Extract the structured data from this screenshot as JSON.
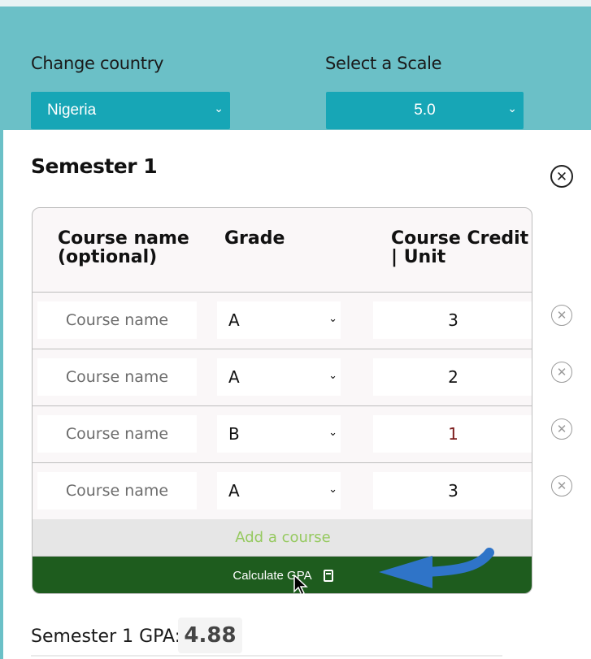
{
  "controls": {
    "country_label": "Change country",
    "country_value": "Nigeria",
    "scale_label": "Select a Scale",
    "scale_value": "5.0"
  },
  "semester": {
    "title": "Semester 1",
    "headers": {
      "course": "Course name (optional)",
      "grade": "Grade",
      "credit": "Course Credit | Unit"
    },
    "rows": [
      {
        "course_placeholder": "Course name",
        "grade": "A",
        "credit": "3"
      },
      {
        "course_placeholder": "Course name",
        "grade": "A",
        "credit": "2"
      },
      {
        "course_placeholder": "Course name",
        "grade": "B",
        "credit": "1"
      },
      {
        "course_placeholder": "Course name",
        "grade": "A",
        "credit": "3"
      }
    ],
    "add_course_label": "Add a course",
    "calculate_label": "Calculate GPA",
    "gpa_label": "Semester 1 GPA:",
    "gpa_value": "4.88"
  },
  "colors": {
    "header_bg": "#6bc0c7",
    "select_bg": "#17a6b6",
    "calculate_bg": "#1e5c1e",
    "add_course_text": "#95c95f",
    "annotation_arrow": "#2f74c8"
  },
  "icons": {
    "select_chevron": "chevron-down-icon",
    "remove": "close-circle-icon",
    "calculate": "calculator-icon"
  }
}
